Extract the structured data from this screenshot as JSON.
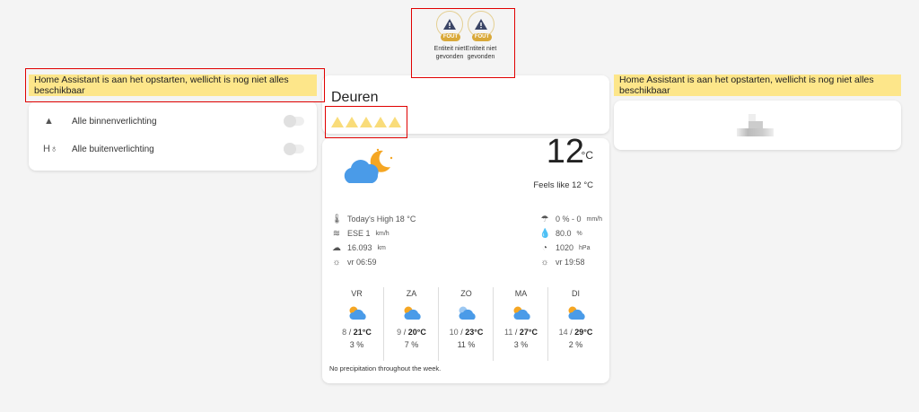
{
  "errors": [
    {
      "badge": "FOUT",
      "label": "Entiteit niet gevonden"
    },
    {
      "badge": "FOUT",
      "label": "Entiteit niet gevonden"
    }
  ],
  "startup_warning": "Home Assistant is aan het opstarten, wellicht is nog niet alles beschikbaar",
  "lights": [
    {
      "label": "Alle binnenverlichting",
      "icon": "ceiling-light-icon",
      "on": false
    },
    {
      "label": "Alle buitenverlichting",
      "icon": "outdoor-lamp-icon",
      "on": false
    }
  ],
  "doors": {
    "title": "Deuren",
    "warning_count": 5
  },
  "weather": {
    "temperature": "12",
    "unit": "°C",
    "feels_like": "Feels like 12 °C",
    "left": [
      {
        "icon": "thermometer-icon",
        "value": "Today's High 18 °C",
        "unit": ""
      },
      {
        "icon": "wind-icon",
        "value": "ESE 1",
        "unit": "km/h"
      },
      {
        "icon": "visibility-icon",
        "value": "16.093",
        "unit": "km"
      },
      {
        "icon": "sunrise-icon",
        "value": "vr 06:59",
        "unit": ""
      }
    ],
    "right": [
      {
        "icon": "rain-icon",
        "value": "0 % - 0",
        "unit": "mm/h"
      },
      {
        "icon": "humidity-icon",
        "value": "80.0",
        "unit": "%"
      },
      {
        "icon": "pressure-icon",
        "value": "1020",
        "unit": "hPa"
      },
      {
        "icon": "sunset-icon",
        "value": "vr 19:58",
        "unit": ""
      }
    ],
    "forecast": [
      {
        "day": "VR",
        "low": "8",
        "high": "21°C",
        "precip": "3 %"
      },
      {
        "day": "ZA",
        "low": "9",
        "high": "20°C",
        "precip": "7 %"
      },
      {
        "day": "ZO",
        "low": "10",
        "high": "23°C",
        "precip": "11 %"
      },
      {
        "day": "MA",
        "low": "11",
        "high": "27°C",
        "precip": "3 %"
      },
      {
        "day": "DI",
        "low": "14",
        "high": "29°C",
        "precip": "2 %"
      }
    ],
    "summary": "No precipitation throughout the week."
  }
}
